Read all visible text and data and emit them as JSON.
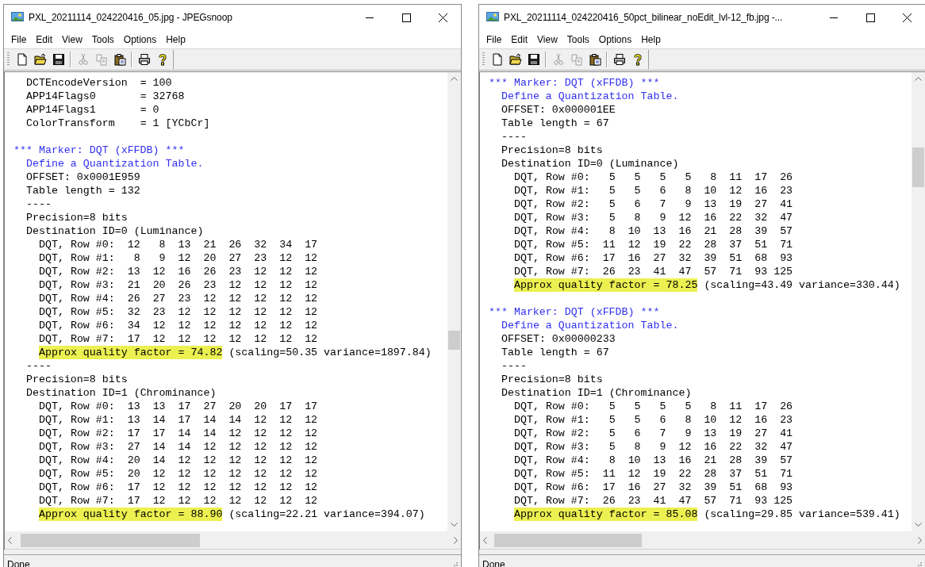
{
  "windows": [
    {
      "title": "PXL_20211114_024220416_05.jpg - JPEGsnoop",
      "menu": [
        "File",
        "Edit",
        "View",
        "Tools",
        "Options",
        "Help"
      ],
      "toolbar": [
        {
          "kind": "new",
          "disabled": false
        },
        {
          "kind": "open",
          "disabled": false
        },
        {
          "kind": "save",
          "disabled": false
        },
        {
          "kind": "separator"
        },
        {
          "kind": "cut",
          "disabled": true
        },
        {
          "kind": "copy",
          "disabled": true
        },
        {
          "kind": "paste",
          "disabled": false
        },
        {
          "kind": "separator"
        },
        {
          "kind": "print",
          "disabled": false
        },
        {
          "kind": "help",
          "disabled": false
        }
      ],
      "lines": [
        {
          "kind": "text",
          "text": "DCTEncodeVersion  = 100"
        },
        {
          "kind": "text",
          "text": "APP14Flags0       = 32768"
        },
        {
          "kind": "text",
          "text": "APP14Flags1       = 0"
        },
        {
          "kind": "text",
          "text": "ColorTransform    = 1 [YCbCr]"
        },
        {
          "kind": "gap"
        },
        {
          "kind": "marker",
          "text": "*** Marker: DQT (xFFDB) ***"
        },
        {
          "kind": "heading",
          "text": "Define a Quantization Table."
        },
        {
          "kind": "text",
          "text": "OFFSET: 0x0001E959"
        },
        {
          "kind": "text",
          "text": "Table length = 132"
        },
        {
          "kind": "text",
          "text": "----"
        },
        {
          "kind": "text",
          "text": "Precision=8 bits"
        },
        {
          "kind": "text",
          "text": "Destination ID=0 (Luminance)"
        },
        {
          "kind": "row",
          "text": "DQT, Row #0:  12   8  13  21  26  32  34  17"
        },
        {
          "kind": "row",
          "text": "DQT, Row #1:   8   9  12  20  27  23  12  12"
        },
        {
          "kind": "row",
          "text": "DQT, Row #2:  13  12  16  26  23  12  12  12"
        },
        {
          "kind": "row",
          "text": "DQT, Row #3:  21  20  26  23  12  12  12  12"
        },
        {
          "kind": "row",
          "text": "DQT, Row #4:  26  27  23  12  12  12  12  12"
        },
        {
          "kind": "row",
          "text": "DQT, Row #5:  32  23  12  12  12  12  12  12"
        },
        {
          "kind": "row",
          "text": "DQT, Row #6:  34  12  12  12  12  12  12  12"
        },
        {
          "kind": "row",
          "text": "DQT, Row #7:  17  12  12  12  12  12  12  12"
        },
        {
          "kind": "quality",
          "highlight": "Approx quality factor = 74.82",
          "text": "(scaling=50.35 variance=1897.84)"
        },
        {
          "kind": "text",
          "text": "----"
        },
        {
          "kind": "text",
          "text": "Precision=8 bits"
        },
        {
          "kind": "text",
          "text": "Destination ID=1 (Chrominance)"
        },
        {
          "kind": "row",
          "text": "DQT, Row #0:  13  13  17  27  20  20  17  17"
        },
        {
          "kind": "row",
          "text": "DQT, Row #1:  13  14  17  14  14  12  12  12"
        },
        {
          "kind": "row",
          "text": "DQT, Row #2:  17  17  14  14  12  12  12  12"
        },
        {
          "kind": "row",
          "text": "DQT, Row #3:  27  14  14  12  12  12  12  12"
        },
        {
          "kind": "row",
          "text": "DQT, Row #4:  20  14  12  12  12  12  12  12"
        },
        {
          "kind": "row",
          "text": "DQT, Row #5:  20  12  12  12  12  12  12  12"
        },
        {
          "kind": "row",
          "text": "DQT, Row #6:  17  12  12  12  12  12  12  12"
        },
        {
          "kind": "row",
          "text": "DQT, Row #7:  17  12  12  12  12  12  12  12"
        },
        {
          "kind": "quality",
          "highlight": "Approx quality factor = 88.90",
          "text": "(scaling=22.21 variance=394.07)"
        }
      ],
      "status": "Done"
    },
    {
      "title": "PXL_20211114_024220416_50pct_bilinear_noEdit_lvl-12_fb.jpg -...",
      "menu": [
        "File",
        "Edit",
        "View",
        "Tools",
        "Options",
        "Help"
      ],
      "toolbar": [
        {
          "kind": "new",
          "disabled": false
        },
        {
          "kind": "open",
          "disabled": false
        },
        {
          "kind": "save",
          "disabled": false
        },
        {
          "kind": "separator"
        },
        {
          "kind": "cut",
          "disabled": true
        },
        {
          "kind": "copy",
          "disabled": true
        },
        {
          "kind": "paste",
          "disabled": false
        },
        {
          "kind": "separator"
        },
        {
          "kind": "print",
          "disabled": false
        },
        {
          "kind": "help",
          "disabled": false
        }
      ],
      "lines": [
        {
          "kind": "marker",
          "text": "*** Marker: DQT (xFFDB) ***"
        },
        {
          "kind": "heading",
          "text": "Define a Quantization Table."
        },
        {
          "kind": "text",
          "text": "OFFSET: 0x000001EE"
        },
        {
          "kind": "text",
          "text": "Table length = 67"
        },
        {
          "kind": "text",
          "text": "----"
        },
        {
          "kind": "text",
          "text": "Precision=8 bits"
        },
        {
          "kind": "text",
          "text": "Destination ID=0 (Luminance)"
        },
        {
          "kind": "row",
          "text": "DQT, Row #0:   5   5   5   5   8  11  17  26"
        },
        {
          "kind": "row",
          "text": "DQT, Row #1:   5   5   6   8  10  12  16  23"
        },
        {
          "kind": "row",
          "text": "DQT, Row #2:   5   6   7   9  13  19  27  41"
        },
        {
          "kind": "row",
          "text": "DQT, Row #3:   5   8   9  12  16  22  32  47"
        },
        {
          "kind": "row",
          "text": "DQT, Row #4:   8  10  13  16  21  28  39  57"
        },
        {
          "kind": "row",
          "text": "DQT, Row #5:  11  12  19  22  28  37  51  71"
        },
        {
          "kind": "row",
          "text": "DQT, Row #6:  17  16  27  32  39  51  68  93"
        },
        {
          "kind": "row",
          "text": "DQT, Row #7:  26  23  41  47  57  71  93 125"
        },
        {
          "kind": "quality",
          "highlight": "Approx quality factor = 78.25",
          "text": "(scaling=43.49 variance=330.44)"
        },
        {
          "kind": "gap"
        },
        {
          "kind": "marker",
          "text": "*** Marker: DQT (xFFDB) ***"
        },
        {
          "kind": "heading",
          "text": "Define a Quantization Table."
        },
        {
          "kind": "text",
          "text": "OFFSET: 0x00000233"
        },
        {
          "kind": "text",
          "text": "Table length = 67"
        },
        {
          "kind": "text",
          "text": "----"
        },
        {
          "kind": "text",
          "text": "Precision=8 bits"
        },
        {
          "kind": "text",
          "text": "Destination ID=1 (Chrominance)"
        },
        {
          "kind": "row",
          "text": "DQT, Row #0:   5   5   5   5   8  11  17  26"
        },
        {
          "kind": "row",
          "text": "DQT, Row #1:   5   5   6   8  10  12  16  23"
        },
        {
          "kind": "row",
          "text": "DQT, Row #2:   5   6   7   9  13  19  27  41"
        },
        {
          "kind": "row",
          "text": "DQT, Row #3:   5   8   9  12  16  22  32  47"
        },
        {
          "kind": "row",
          "text": "DQT, Row #4:   8  10  13  16  21  28  39  57"
        },
        {
          "kind": "row",
          "text": "DQT, Row #5:  11  12  19  22  28  37  51  71"
        },
        {
          "kind": "row",
          "text": "DQT, Row #6:  17  16  27  32  39  51  68  93"
        },
        {
          "kind": "row",
          "text": "DQT, Row #7:  26  23  41  47  57  71  93 125"
        },
        {
          "kind": "quality",
          "highlight": "Approx quality factor = 85.08",
          "text": "(scaling=29.85 variance=539.41)"
        }
      ],
      "status": "Done"
    }
  ]
}
